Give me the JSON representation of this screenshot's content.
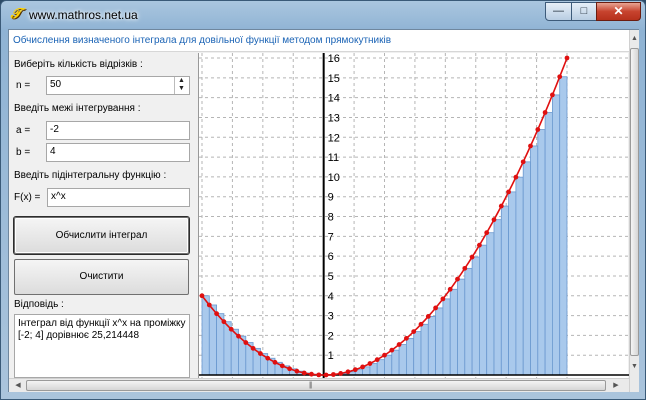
{
  "window": {
    "title": "www.mathros.net.ua",
    "icon": "app-logo-icon",
    "minimize_label": "—",
    "maximize_label": "□",
    "close_label": "✕"
  },
  "header": {
    "text": "Обчислення визначеного інтеграла для довільної функції методом прямокутників"
  },
  "form": {
    "n_section_label": "Виберіть кількість відрізків :",
    "n_label": "n  =",
    "n_value": "50",
    "bounds_section_label": "Введіть межі інтегрування :",
    "a_label": "a  =",
    "a_value": "-2",
    "b_label": "b  =",
    "b_value": "4",
    "func_section_label": "Введіть підінтегральну функцію :",
    "f_label": "F(x)  =",
    "f_value": "x^x"
  },
  "buttons": {
    "calculate": "Обчислити інтеграл",
    "clear": "Очистити"
  },
  "answer": {
    "label": "Відповідь :",
    "text": "Інтеграл від функції x^x на проміжку [-2; 4] дорівнює 25,214448"
  },
  "chart_data": {
    "type": "bar",
    "function": "x^2",
    "x_range": [
      -2,
      4
    ],
    "n": 50,
    "ylim": [
      0,
      16
    ],
    "y_ticks": [
      "1",
      "2",
      "3",
      "4",
      "5",
      "6",
      "7",
      "8",
      "9",
      "10",
      "11",
      "12",
      "13",
      "14",
      "15",
      "16"
    ],
    "colors": {
      "bar_fill": "#a9c9ec",
      "bar_stroke": "#6a98cf",
      "curve": "#e01010",
      "points": "#e01010",
      "grid": "#b5b5b5",
      "axis": "#000000"
    }
  }
}
